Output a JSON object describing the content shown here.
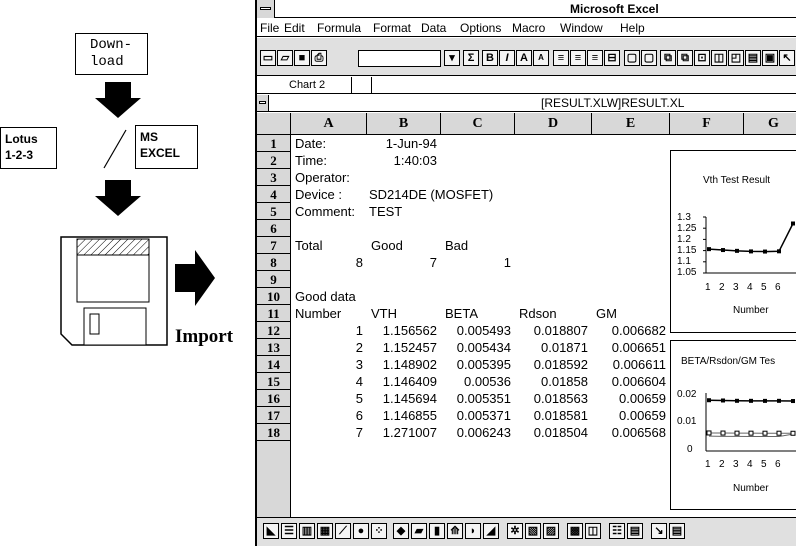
{
  "diagram": {
    "download_label": "Down-\nload",
    "lotus_label": "Lotus\n1-2-3",
    "excel_label": "MS\nEXCEL",
    "separator": "/",
    "import_label": "Import"
  },
  "excel": {
    "app_title": "Microsoft Excel",
    "menu": [
      "File",
      "Edit",
      "Formula",
      "Format",
      "Data",
      "Options",
      "Macro",
      "Window",
      "Help"
    ],
    "name_box": "Chart 2",
    "doc_title": "[RESULT.XLW]RESULT.XL",
    "columns": [
      "A",
      "B",
      "C",
      "D",
      "E",
      "F",
      "G"
    ],
    "row_numbers": [
      "1",
      "2",
      "3",
      "4",
      "5",
      "6",
      "7",
      "8",
      "9",
      "10",
      "11",
      "12",
      "13",
      "14",
      "15",
      "16",
      "17",
      "18"
    ],
    "cells": {
      "r1": [
        "Date:",
        "1-Jun-94"
      ],
      "r2": [
        "Time:",
        "1:40:03"
      ],
      "r3": [
        "Operator:"
      ],
      "r4": [
        "Device :",
        "SD214DE (MOSFET)"
      ],
      "r5": [
        "Comment:",
        "TEST"
      ],
      "r7": [
        "Total",
        "Good",
        "Bad"
      ],
      "r8": [
        "8",
        "7",
        "1"
      ],
      "r10": [
        "Good data"
      ],
      "r11": [
        "Number",
        "VTH",
        "BETA",
        "Rdson",
        "GM"
      ],
      "data_rows": [
        [
          "1",
          "1.156562",
          "0.005493",
          "0.018807",
          "0.006682"
        ],
        [
          "2",
          "1.152457",
          "0.005434",
          "0.01871",
          "0.006651"
        ],
        [
          "3",
          "1.148902",
          "0.005395",
          "0.018592",
          "0.006611"
        ],
        [
          "4",
          "1.146409",
          "0.00536",
          "0.01858",
          "0.006604"
        ],
        [
          "5",
          "1.145694",
          "0.005351",
          "0.018563",
          "0.00659"
        ],
        [
          "6",
          "1.146855",
          "0.005371",
          "0.018581",
          "0.00659"
        ],
        [
          "7",
          "1.271007",
          "0.006243",
          "0.018504",
          "0.006568"
        ]
      ]
    },
    "chart1": {
      "title": "Vth Test Result",
      "y_ticks": [
        "1.3",
        "1.25",
        "1.2",
        "1.15",
        "1.1",
        "1.05"
      ],
      "x_ticks": [
        "1",
        "2",
        "3",
        "4",
        "5",
        "6"
      ],
      "xlabel": "Number",
      "values": [
        1.156562,
        1.152457,
        1.148902,
        1.146409,
        1.145694,
        1.146855,
        1.271007
      ]
    },
    "chart2": {
      "title": "BETA/Rsdon/GM Tes",
      "y_ticks": [
        "0.02",
        "0.01",
        "0"
      ],
      "x_ticks": [
        "1",
        "2",
        "3",
        "4",
        "5",
        "6"
      ],
      "xlabel": "Number"
    }
  }
}
